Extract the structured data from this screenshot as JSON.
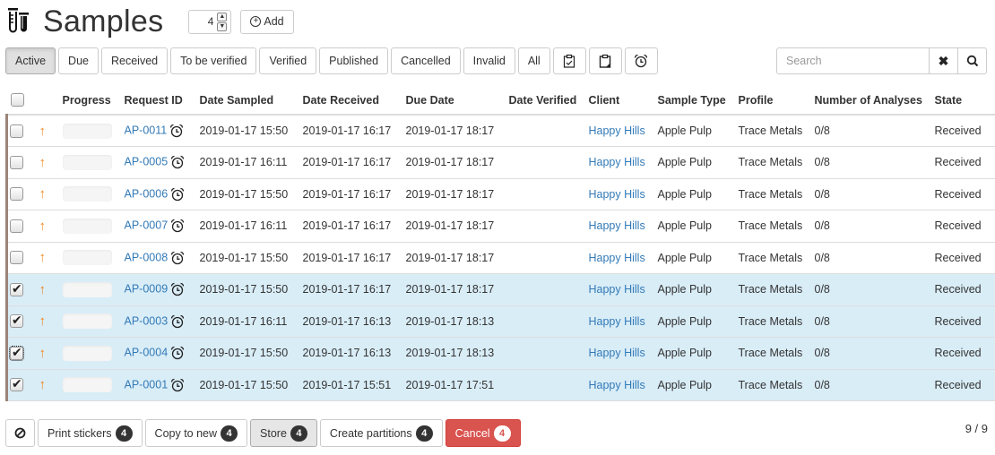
{
  "header": {
    "title": "Samples",
    "icon": "test-tube-icon",
    "spinner_value": "4",
    "add_label": "Add"
  },
  "filters": [
    {
      "label": "Active",
      "active": true
    },
    {
      "label": "Due"
    },
    {
      "label": "Received"
    },
    {
      "label": "To be verified"
    },
    {
      "label": "Verified"
    },
    {
      "label": "Published"
    },
    {
      "label": "Cancelled"
    },
    {
      "label": "Invalid"
    },
    {
      "label": "All"
    }
  ],
  "filter_icons": [
    "clipboard-check-icon",
    "clipboard-icon",
    "alarm-clock-icon"
  ],
  "search": {
    "placeholder": "Search",
    "value": ""
  },
  "table": {
    "columns": [
      "Progress",
      "Request ID",
      "Date Sampled",
      "Date Received",
      "Due Date",
      "Date Verified",
      "Client",
      "Sample Type",
      "Profile",
      "Number of Analyses",
      "State"
    ],
    "rows": [
      {
        "checked": false,
        "id": "AP-0011",
        "sampled": "2019-01-17 15:50",
        "received": "2019-01-17 16:17",
        "due": "2019-01-17 18:17",
        "verified": "",
        "client": "Happy Hills",
        "type": "Apple Pulp",
        "profile": "Trace Metals",
        "analyses": "0/8",
        "state": "Received",
        "progress": 0
      },
      {
        "checked": false,
        "id": "AP-0005",
        "sampled": "2019-01-17 16:11",
        "received": "2019-01-17 16:17",
        "due": "2019-01-17 18:17",
        "verified": "",
        "client": "Happy Hills",
        "type": "Apple Pulp",
        "profile": "Trace Metals",
        "analyses": "0/8",
        "state": "Received",
        "progress": 0
      },
      {
        "checked": false,
        "id": "AP-0006",
        "sampled": "2019-01-17 15:50",
        "received": "2019-01-17 16:17",
        "due": "2019-01-17 18:17",
        "verified": "",
        "client": "Happy Hills",
        "type": "Apple Pulp",
        "profile": "Trace Metals",
        "analyses": "0/8",
        "state": "Received",
        "progress": 0
      },
      {
        "checked": false,
        "id": "AP-0007",
        "sampled": "2019-01-17 16:11",
        "received": "2019-01-17 16:17",
        "due": "2019-01-17 18:17",
        "verified": "",
        "client": "Happy Hills",
        "type": "Apple Pulp",
        "profile": "Trace Metals",
        "analyses": "0/8",
        "state": "Received",
        "progress": 0
      },
      {
        "checked": false,
        "id": "AP-0008",
        "sampled": "2019-01-17 15:50",
        "received": "2019-01-17 16:17",
        "due": "2019-01-17 18:17",
        "verified": "",
        "client": "Happy Hills",
        "type": "Apple Pulp",
        "profile": "Trace Metals",
        "analyses": "0/8",
        "state": "Received",
        "progress": 0
      },
      {
        "checked": true,
        "id": "AP-0009",
        "sampled": "2019-01-17 15:50",
        "received": "2019-01-17 16:17",
        "due": "2019-01-17 18:17",
        "verified": "",
        "client": "Happy Hills",
        "type": "Apple Pulp",
        "profile": "Trace Metals",
        "analyses": "0/8",
        "state": "Received",
        "progress": 0
      },
      {
        "checked": true,
        "id": "AP-0003",
        "sampled": "2019-01-17 16:11",
        "received": "2019-01-17 16:13",
        "due": "2019-01-17 18:13",
        "verified": "",
        "client": "Happy Hills",
        "type": "Apple Pulp",
        "profile": "Trace Metals",
        "analyses": "0/8",
        "state": "Received",
        "progress": 0
      },
      {
        "checked": true,
        "focused": true,
        "id": "AP-0004",
        "sampled": "2019-01-17 15:50",
        "received": "2019-01-17 16:13",
        "due": "2019-01-17 18:13",
        "verified": "",
        "client": "Happy Hills",
        "type": "Apple Pulp",
        "profile": "Trace Metals",
        "analyses": "0/8",
        "state": "Received",
        "progress": 0
      },
      {
        "checked": true,
        "id": "AP-0001",
        "sampled": "2019-01-17 15:50",
        "received": "2019-01-17 15:51",
        "due": "2019-01-17 17:51",
        "verified": "",
        "client": "Happy Hills",
        "type": "Apple Pulp",
        "profile": "Trace Metals",
        "analyses": "0/8",
        "state": "Received",
        "progress": 0
      }
    ]
  },
  "actions": [
    {
      "label": "Print stickers",
      "count": "4"
    },
    {
      "label": "Copy to new",
      "count": "4"
    },
    {
      "label": "Store",
      "count": "4",
      "pressed": true
    },
    {
      "label": "Create partitions",
      "count": "4"
    },
    {
      "label": "Cancel",
      "count": "4",
      "danger": true
    }
  ],
  "pagination": {
    "text": "9 / 9"
  },
  "colors": {
    "accent": "#337ab7",
    "danger": "#d9534f",
    "priority": "#f0851a",
    "selected_row": "#d9edf7"
  }
}
